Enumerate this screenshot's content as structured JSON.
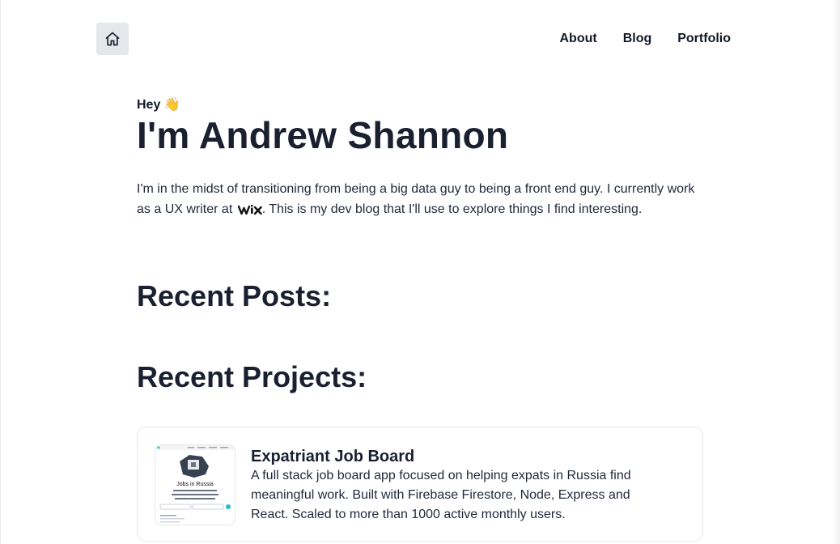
{
  "nav": {
    "home_icon": "home-icon",
    "items": [
      {
        "label": "About"
      },
      {
        "label": "Blog"
      },
      {
        "label": "Portfolio"
      }
    ]
  },
  "hero": {
    "greeting": "Hey",
    "wave_emoji": "👋",
    "name": "I'm Andrew Shannon",
    "intro_before_logo": "I'm in the midst of transitioning from being a big data guy to being a front end guy. I currently work as a UX writer at ",
    "company_logo_text": "wix",
    "intro_after_logo": ". This is my dev blog that I'll use to explore things I find interesting."
  },
  "sections": {
    "recent_posts_title": "Recent Posts:",
    "recent_projects_title": "Recent Projects:"
  },
  "projects": [
    {
      "title": "Expatriant Job Board",
      "description": "A full stack job board app focused on helping expats in Russia find meaningful work. Built with Firebase Firestore, Node, Express and React. Scaled to more than 1000 active monthly users.",
      "thumbnail_text": "Jobs in Russia"
    }
  ],
  "colors": {
    "text": "#111827",
    "heading": "#1a2030",
    "home_button_bg": "#e5e7eb",
    "card_border": "#e5e7eb"
  }
}
